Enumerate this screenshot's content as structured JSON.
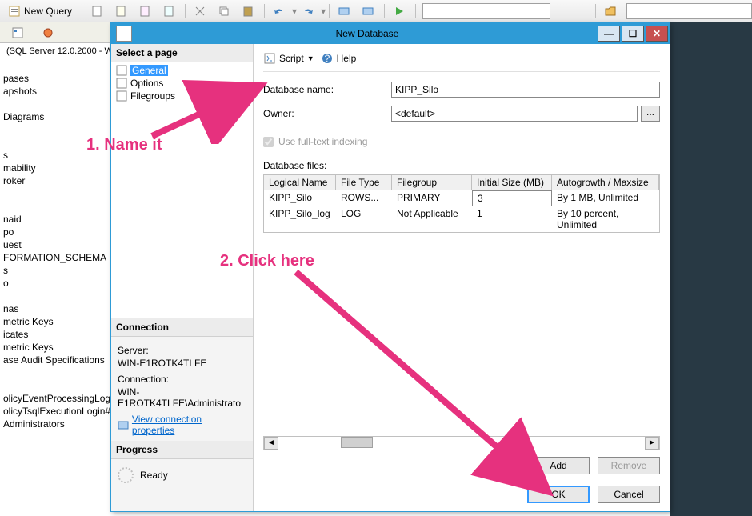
{
  "toolbar": {
    "new_query": "New Query"
  },
  "server_info": "(SQL Server 12.0.2000 - W",
  "tree": [
    "pases",
    "apshots",
    "",
    "Diagrams",
    "",
    "",
    "s",
    "mability",
    "roker",
    "",
    "",
    "naid",
    "po",
    "uest",
    "FORMATION_SCHEMA",
    "s",
    "o",
    "",
    "nas",
    "metric Keys",
    "icates",
    "metric Keys",
    "ase Audit Specifications",
    "",
    "",
    "olicyEventProcessingLogin",
    "olicyTsqlExecutionLogin#",
    "Administrators"
  ],
  "dialog": {
    "title": "New Database",
    "left_heads": {
      "select_page": "Select a page",
      "connection": "Connection",
      "progress": "Progress"
    },
    "pages": [
      {
        "label": "General",
        "selected": true
      },
      {
        "label": "Options",
        "selected": false
      },
      {
        "label": "Filegroups",
        "selected": false
      }
    ],
    "connection": {
      "server_lbl": "Server:",
      "server_val": "WIN-E1ROTK4TLFE",
      "conn_lbl": "Connection:",
      "conn_val": "WIN-E1ROTK4TLFE\\Administrato",
      "link": "View connection properties"
    },
    "progress": {
      "status": "Ready"
    },
    "script_label": "Script",
    "help_label": "Help",
    "form": {
      "db_name_lbl": "Database name:",
      "db_name_val": "KIPP_Silo",
      "owner_lbl": "Owner:",
      "owner_val": "<default>",
      "fulltext_lbl": "Use full-text indexing",
      "files_lbl": "Database files:",
      "cols": {
        "name": "Logical Name",
        "type": "File Type",
        "fg": "Filegroup",
        "size": "Initial Size (MB)",
        "grow": "Autogrowth / Maxsize"
      },
      "rows": [
        {
          "name": "KIPP_Silo",
          "type": "ROWS...",
          "fg": "PRIMARY",
          "size": "3",
          "grow": "By 1 MB, Unlimited"
        },
        {
          "name": "KIPP_Silo_log",
          "type": "LOG",
          "fg": "Not Applicable",
          "size": "1",
          "grow": "By 10 percent, Unlimited"
        }
      ]
    },
    "buttons": {
      "add": "Add",
      "remove": "Remove",
      "ok": "OK",
      "cancel": "Cancel"
    }
  },
  "annotations": {
    "a1": "1. Name it",
    "a2": "2. Click here"
  }
}
